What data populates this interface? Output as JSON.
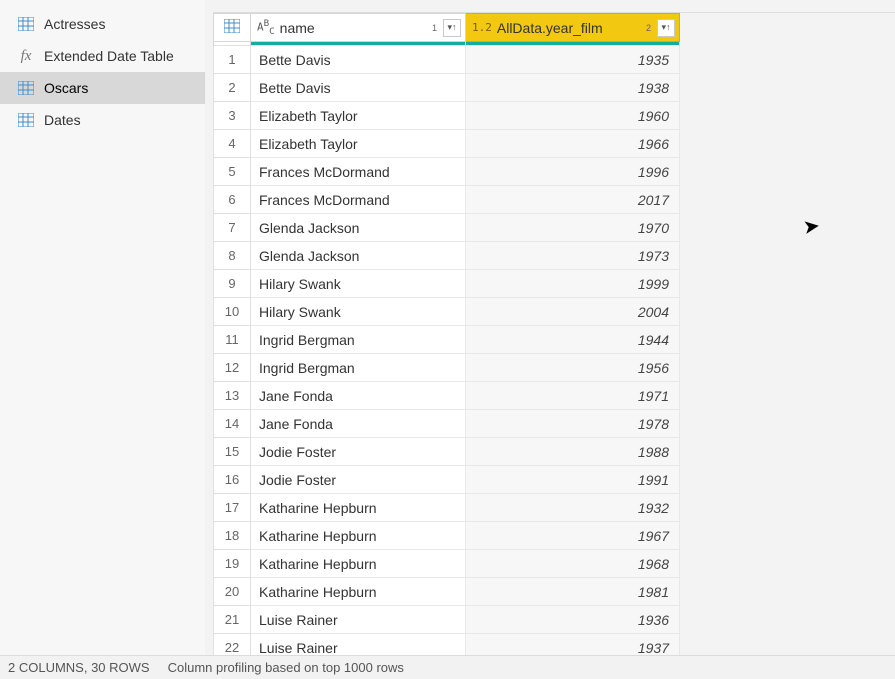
{
  "sidebar": {
    "items": [
      {
        "label": "Actresses",
        "kind": "table",
        "selected": false
      },
      {
        "label": "Extended Date Table",
        "kind": "fx",
        "selected": false
      },
      {
        "label": "Oscars",
        "kind": "table",
        "selected": true
      },
      {
        "label": "Dates",
        "kind": "table",
        "selected": false
      }
    ]
  },
  "columns": {
    "name": {
      "type_label": "ABC",
      "title": "name",
      "sort_index": "1",
      "sort_dir": "asc",
      "selected": false
    },
    "year": {
      "type_label": "1.2",
      "title": "AllData.year_film",
      "sort_index": "2",
      "sort_dir": "asc",
      "selected": true
    }
  },
  "rows": [
    {
      "n": 1,
      "name": "Bette Davis",
      "year": 1935
    },
    {
      "n": 2,
      "name": "Bette Davis",
      "year": 1938
    },
    {
      "n": 3,
      "name": "Elizabeth Taylor",
      "year": 1960
    },
    {
      "n": 4,
      "name": "Elizabeth Taylor",
      "year": 1966
    },
    {
      "n": 5,
      "name": "Frances McDormand",
      "year": 1996
    },
    {
      "n": 6,
      "name": "Frances McDormand",
      "year": 2017
    },
    {
      "n": 7,
      "name": "Glenda Jackson",
      "year": 1970
    },
    {
      "n": 8,
      "name": "Glenda Jackson",
      "year": 1973
    },
    {
      "n": 9,
      "name": "Hilary Swank",
      "year": 1999
    },
    {
      "n": 10,
      "name": "Hilary Swank",
      "year": 2004
    },
    {
      "n": 11,
      "name": "Ingrid Bergman",
      "year": 1944
    },
    {
      "n": 12,
      "name": "Ingrid Bergman",
      "year": 1956
    },
    {
      "n": 13,
      "name": "Jane Fonda",
      "year": 1971
    },
    {
      "n": 14,
      "name": "Jane Fonda",
      "year": 1978
    },
    {
      "n": 15,
      "name": "Jodie Foster",
      "year": 1988
    },
    {
      "n": 16,
      "name": "Jodie Foster",
      "year": 1991
    },
    {
      "n": 17,
      "name": "Katharine Hepburn",
      "year": 1932
    },
    {
      "n": 18,
      "name": "Katharine Hepburn",
      "year": 1967
    },
    {
      "n": 19,
      "name": "Katharine Hepburn",
      "year": 1968
    },
    {
      "n": 20,
      "name": "Katharine Hepburn",
      "year": 1981
    },
    {
      "n": 21,
      "name": "Luise Rainer",
      "year": 1936
    },
    {
      "n": 22,
      "name": "Luise Rainer",
      "year": 1937
    }
  ],
  "status": {
    "summary": "2 COLUMNS, 30 ROWS",
    "profiling": "Column profiling based on top 1000 rows"
  },
  "chart_data": {
    "type": "table",
    "columns": [
      "name",
      "AllData.year_film"
    ],
    "rows": [
      [
        "Bette Davis",
        1935
      ],
      [
        "Bette Davis",
        1938
      ],
      [
        "Elizabeth Taylor",
        1960
      ],
      [
        "Elizabeth Taylor",
        1966
      ],
      [
        "Frances McDormand",
        1996
      ],
      [
        "Frances McDormand",
        2017
      ],
      [
        "Glenda Jackson",
        1970
      ],
      [
        "Glenda Jackson",
        1973
      ],
      [
        "Hilary Swank",
        1999
      ],
      [
        "Hilary Swank",
        2004
      ],
      [
        "Ingrid Bergman",
        1944
      ],
      [
        "Ingrid Bergman",
        1956
      ],
      [
        "Jane Fonda",
        1971
      ],
      [
        "Jane Fonda",
        1978
      ],
      [
        "Jodie Foster",
        1988
      ],
      [
        "Jodie Foster",
        1991
      ],
      [
        "Katharine Hepburn",
        1932
      ],
      [
        "Katharine Hepburn",
        1967
      ],
      [
        "Katharine Hepburn",
        1968
      ],
      [
        "Katharine Hepburn",
        1981
      ],
      [
        "Luise Rainer",
        1936
      ],
      [
        "Luise Rainer",
        1937
      ]
    ]
  }
}
